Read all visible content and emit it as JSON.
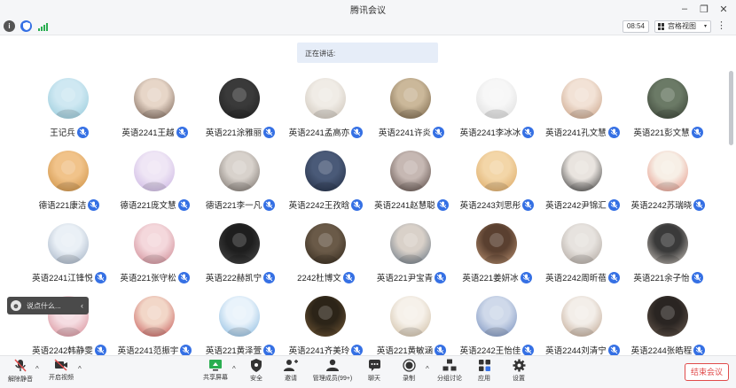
{
  "window": {
    "title": "腾讯会议"
  },
  "topbar": {
    "time": "08:54",
    "view_label": "宫格视图",
    "icons": [
      "info-icon",
      "shield-icon",
      "signal-icon"
    ]
  },
  "speaking_label": "正在讲话:",
  "participants": [
    {
      "name": "王记兵"
    },
    {
      "name": "英语2241王越"
    },
    {
      "name": "英语221涂雅丽"
    },
    {
      "name": "英语2241孟高亦"
    },
    {
      "name": "英语2241许炎"
    },
    {
      "name": "英语2241李冰冰"
    },
    {
      "name": "英语2241孔文慧"
    },
    {
      "name": "英语221彭文慧"
    },
    {
      "name": "德语221康洁"
    },
    {
      "name": "德语221庞文慧"
    },
    {
      "name": "德语221李一凡"
    },
    {
      "name": "英语2242王孜晗"
    },
    {
      "name": "英语2241赵慧聪"
    },
    {
      "name": "英语2243刘思彤"
    },
    {
      "name": "英语2242尹锦汇"
    },
    {
      "name": "英语2242苏瑞晓"
    },
    {
      "name": "英语2241江锋悦"
    },
    {
      "name": "英语221张守松"
    },
    {
      "name": "英语222赫凯宁"
    },
    {
      "name": "2242杜博文"
    },
    {
      "name": "英语221尹宝青"
    },
    {
      "name": "英语221姜妍冰"
    },
    {
      "name": "英语2242周昕蓓"
    },
    {
      "name": "英语221余子怡"
    },
    {
      "name": "英语2242韩静雯"
    },
    {
      "name": "英语2241范振宇"
    },
    {
      "name": "英语221黄泽萱"
    },
    {
      "name": "英语2241齐美玲"
    },
    {
      "name": "英语221黄敏涵"
    },
    {
      "name": "英语2242王怡佳"
    },
    {
      "name": "英语2244刘清宁"
    },
    {
      "name": "英语2244张皓程"
    }
  ],
  "chat_input": {
    "placeholder": "说点什么..."
  },
  "toolbar": {
    "unmute": "解除静音",
    "video": "开启视频",
    "share": "共享屏幕",
    "security": "安全",
    "invite": "邀请",
    "members": "管理成员(99+)",
    "chat": "聊天",
    "record": "录制",
    "breakout": "分组讨论",
    "apps": "应用",
    "settings": "设置",
    "end": "结束会议"
  },
  "colors": {
    "accent": "#3570e4",
    "end_red": "#e04b4b",
    "signal_green": "#2aae51"
  }
}
